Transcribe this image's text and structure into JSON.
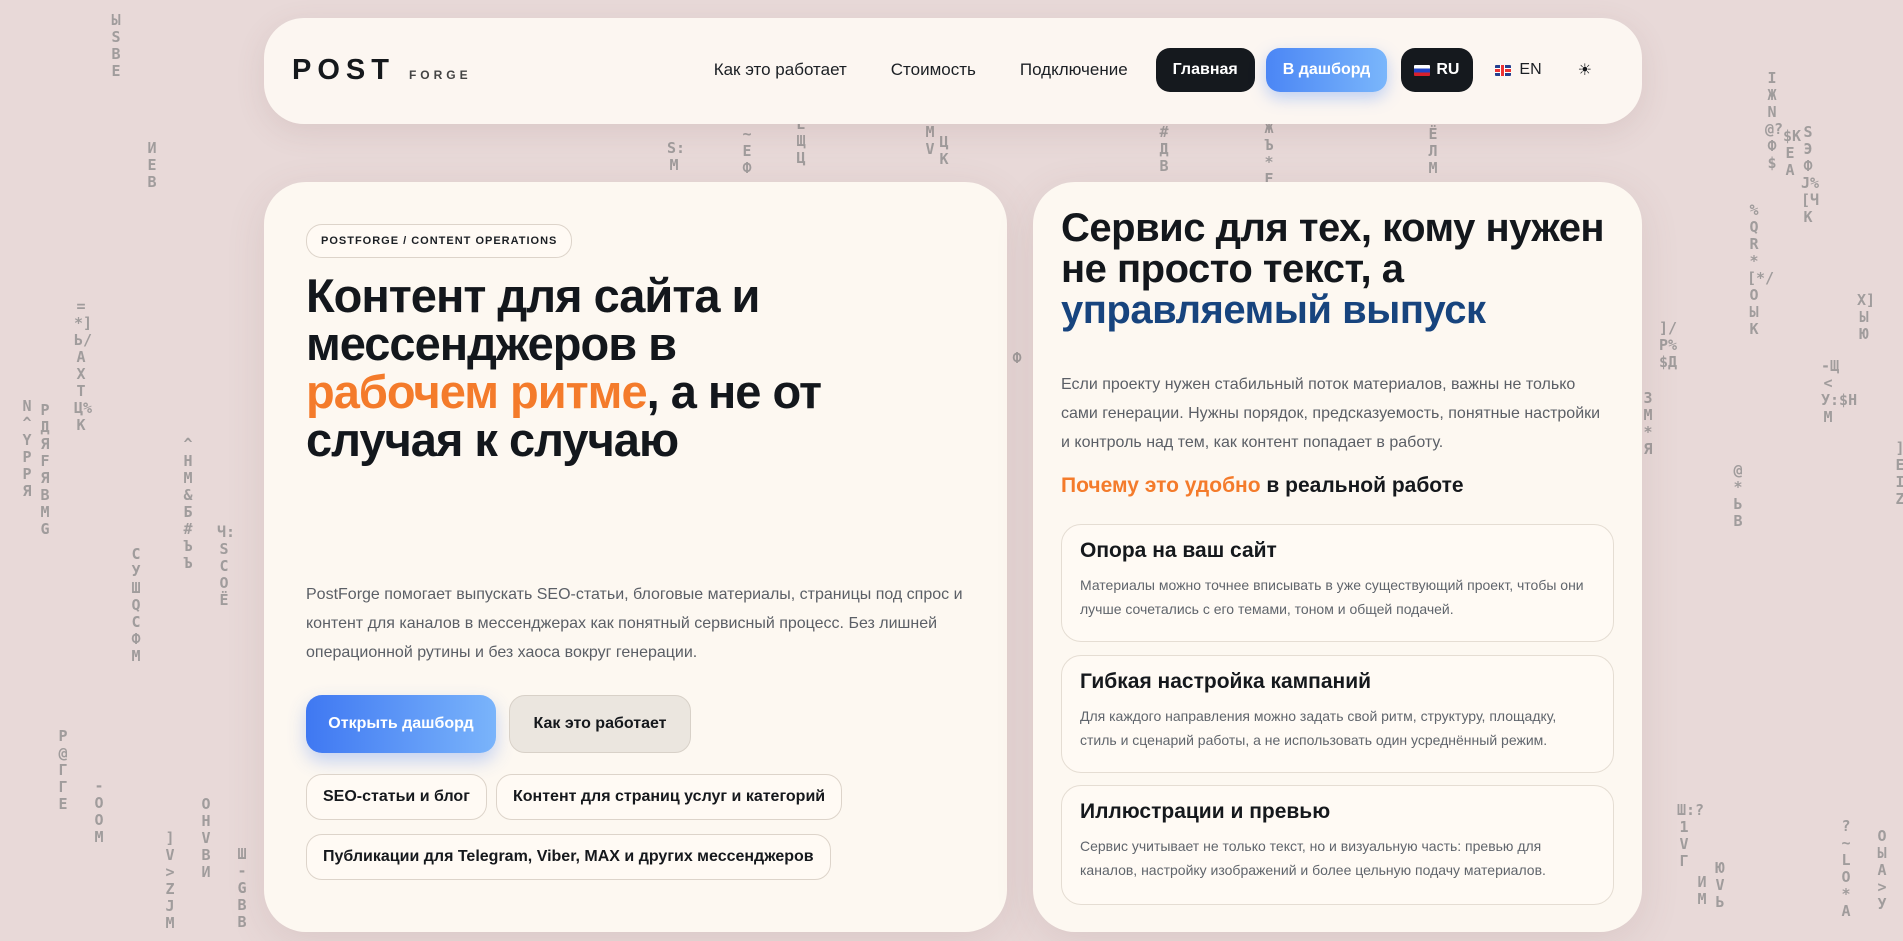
{
  "header": {
    "logo_main": "POST",
    "logo_sub": "FORGE",
    "nav": [
      "Как это работает",
      "Стоимость",
      "Подключение"
    ],
    "home_label": "Главная",
    "dashboard_label": "В дашборд",
    "lang_active": "RU",
    "lang_other": "EN",
    "theme_icon": "☀"
  },
  "hero": {
    "eyebrow": "POSTFORGE / CONTENT OPERATIONS",
    "title_part1": "Контент для сайта и мессенджеров в ",
    "title_accent": "рабочем ритме",
    "title_part2": ", а не от случая к случаю",
    "description": "PostForge помогает выпускать SEO-статьи, блоговые материалы, страницы под спрос и контент для каналов в мессенджерах как понятный сервисный процесс. Без лишней операционной рутины и без хаоса вокруг генерации.",
    "primary_button": "Открыть дашборд",
    "secondary_button": "Как это работает",
    "chips": [
      "SEO-статьи и блог",
      "Контент для страниц услуг и категорий",
      "Публикации для Telegram, Viber, MAX и других мессенджеров"
    ]
  },
  "about": {
    "title_part1": "Сервис для тех, кому нужен не просто текст, а ",
    "title_accent": "управляемый выпуск",
    "description": "Если проекту нужен стабильный поток материалов, важны не только сами генерации. Нужны порядок, предсказуемость, понятные настройки и контроль над тем, как контент попадает в работу.",
    "subtitle_accent": "Почему это удобно",
    "subtitle_rest": " в реальной работе",
    "features": [
      {
        "title": "Опора на ваш сайт",
        "text": "Материалы можно точнее вписывать в уже существующий проект, чтобы они лучше сочетались с его темами, тоном и общей подачей."
      },
      {
        "title": "Гибкая настройка кампаний",
        "text": "Для каждого направления можно задать свой ритм, структуру, площадку, стиль и сценарий работы, а не использовать один усреднённый режим."
      },
      {
        "title": "Иллюстрации и превью",
        "text": "Сервис учитывает не только текст, но и визуальную часть: превью для каналов, настройку изображений и более цельную подачу материалов."
      }
    ]
  },
  "colors": {
    "accent_orange": "#f47b2b",
    "accent_blue": "#17447e",
    "primary_button": "#3f78f2",
    "background": "#e8d9d8"
  }
}
